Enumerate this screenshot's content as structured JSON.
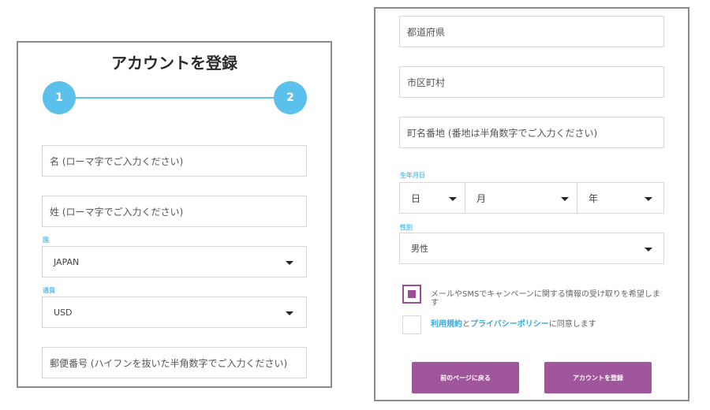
{
  "left": {
    "title": "アカウントを登録",
    "steps": [
      "1",
      "2"
    ],
    "first_name_placeholder": "名 (ローマ字でご入力ください)",
    "last_name_placeholder": "姓 (ローマ字でご入力ください)",
    "country_label": "国",
    "country_value": "JAPAN",
    "currency_label": "通貨",
    "currency_value": "USD",
    "postal_placeholder": "郵便番号 (ハイフンを抜いた半角数字でご入力ください)"
  },
  "right": {
    "prefecture_placeholder": "都道府県",
    "city_placeholder": "市区町村",
    "address_placeholder": "町名番地 (番地は半角数字でご入力ください)",
    "dob_label": "生年月日",
    "dob_day": "日",
    "dob_month": "月",
    "dob_year": "年",
    "gender_label": "性別",
    "gender_value": "男性",
    "marketing_consent": "メールやSMSでキャンペーンに関する情報の受け取りを希望します",
    "terms_link": "利用規約",
    "terms_and": "と",
    "privacy_link": "プライバシーポリシー",
    "terms_suffix": "に同意します",
    "back_button": "前のページに戻る",
    "register_button": "アカウントを登録"
  },
  "colors": {
    "accent_blue": "#5bc0eb",
    "button_purple": "#a0569a"
  }
}
